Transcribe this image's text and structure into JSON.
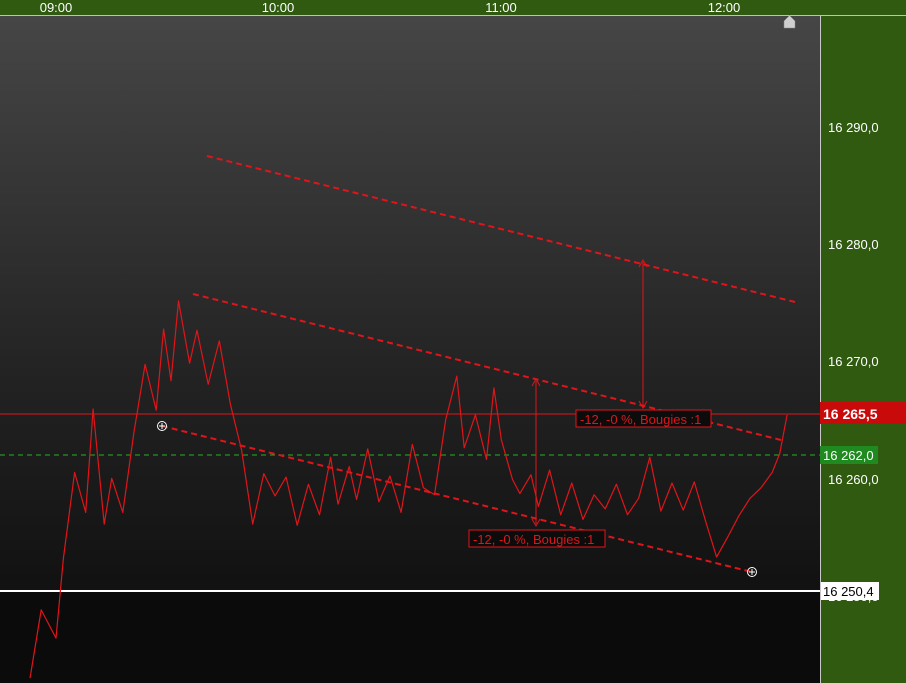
{
  "colors": {
    "axis_bg": "#2f5a10",
    "price_line": "#e0151a",
    "ref_dashed": "#22b522",
    "last_badge": "#c80a0a",
    "ref_badge": "#1f8a1f",
    "support_line": "#ffffff"
  },
  "time_axis": {
    "ticks": [
      "09:00",
      "10:00",
      "11:00",
      "12:00"
    ]
  },
  "price_axis": {
    "ticks": [
      "16 290,0",
      "16 280,0",
      "16 270,0",
      "16 260,0",
      "16 250,0"
    ]
  },
  "badges": {
    "last": "16 265,5",
    "reference": "16 262,0",
    "support": "16 250,4"
  },
  "annotations": {
    "upper": "-12, -0 %, Bougies :1",
    "lower": "-12, -0 %, Bougies :1"
  },
  "chart_data": {
    "type": "line",
    "x_range": [
      "08:53",
      "12:17"
    ],
    "y_range": [
      16235.4,
      16300.0
    ],
    "log_scale": false,
    "grid": false,
    "x_ticks": [
      "09:00",
      "10:00",
      "11:00",
      "12:00"
    ],
    "y_ticks": [
      16290.0,
      16280.0,
      16270.0,
      16260.0,
      16250.0
    ],
    "series": [
      {
        "x": [
          "08:53",
          "08:56",
          "09:00",
          "09:02",
          "09:05",
          "09:08",
          "09:10",
          "09:13",
          "09:15",
          "09:18",
          "09:21",
          "09:24",
          "09:27",
          "09:29",
          "09:31",
          "09:33",
          "09:36",
          "09:38",
          "09:41",
          "09:44",
          "09:47",
          "09:50",
          "09:53",
          "09:56",
          "09:59",
          "10:02",
          "10:05",
          "10:08",
          "10:11",
          "10:14",
          "10:16",
          "10:19",
          "10:21",
          "10:24",
          "10:27",
          "10:30",
          "10:33",
          "10:36",
          "10:39",
          "10:42",
          "10:45",
          "10:48",
          "10:50",
          "10:53",
          "10:56",
          "10:58",
          "11:00",
          "11:03",
          "11:05",
          "11:08",
          "11:10",
          "11:13",
          "11:16",
          "11:19",
          "11:22",
          "11:25",
          "11:28",
          "11:31",
          "11:34",
          "11:37",
          "11:40",
          "11:43",
          "11:46",
          "11:49",
          "11:52",
          "11:55",
          "11:58",
          "12:01",
          "12:04",
          "12:07",
          "12:10",
          "12:13",
          "12:15",
          "12:17"
        ],
        "values": [
          16243.1,
          16248.9,
          16246.5,
          16253.3,
          16260.6,
          16257.2,
          16266.0,
          16256.2,
          16260.1,
          16257.2,
          16264.0,
          16269.8,
          16265.9,
          16272.8,
          16268.4,
          16275.2,
          16269.9,
          16272.7,
          16268.1,
          16271.8,
          16266.4,
          16262.5,
          16256.2,
          16260.5,
          16258.6,
          16260.2,
          16256.1,
          16259.6,
          16257.0,
          16261.9,
          16257.9,
          16261.1,
          16258.3,
          16262.6,
          16258.1,
          16260.3,
          16257.2,
          16263.0,
          16259.3,
          16258.7,
          16265.1,
          16268.8,
          16262.7,
          16265.5,
          16261.7,
          16267.8,
          16263.4,
          16260.0,
          16258.8,
          16260.4,
          16257.7,
          16260.8,
          16257.0,
          16259.7,
          16256.6,
          16258.7,
          16257.5,
          16259.6,
          16257.0,
          16258.4,
          16261.9,
          16257.3,
          16259.7,
          16257.4,
          16259.8,
          16256.5,
          16253.4,
          16255.1,
          16256.9,
          16258.4,
          16259.3,
          16260.6,
          16262.2,
          16265.5
        ]
      }
    ],
    "horizontal_lines": [
      {
        "label": "16 265,5",
        "y": 16265.5
      },
      {
        "label": "16 262,0",
        "y": 16262.0
      },
      {
        "label": "16 250,4",
        "y": 16250.4
      }
    ],
    "trendlines": [
      {
        "start": [
          "09:23",
          16287.9
        ],
        "end": [
          "12:16",
          16274.2
        ]
      },
      {
        "start": [
          "09:22",
          16275.2
        ],
        "end": [
          "12:13",
          16263.8
        ]
      },
      {
        "start": [
          "09:14",
          16264.3
        ],
        "end": [
          "12:06",
          16251.9
        ]
      }
    ],
    "annotations": [
      {
        "text": "-12, -0 %, Bougies :1",
        "at": [
          "11:36",
          16265.4
        ]
      },
      {
        "text": "-12, -0 %, Bougies :1",
        "at": [
          "11:02",
          16255.1
        ]
      }
    ]
  }
}
